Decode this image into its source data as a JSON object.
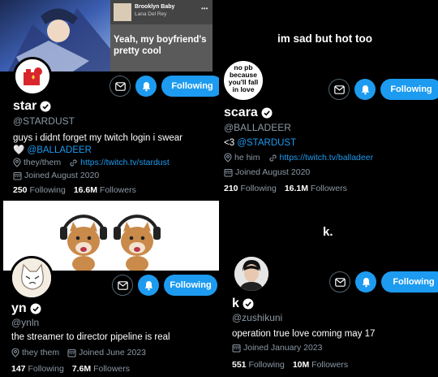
{
  "top_left": {
    "banner_post": {
      "song_title": "Brooklyn Baby",
      "artist": "Lana Del Rey",
      "text": "Yeah, my boyfriend's pretty cool"
    },
    "name": "star",
    "handle": "@STARDUST",
    "bio_text": "guys i didnt forget my twitch login i swear",
    "bio_heart": "🤍",
    "bio_mention": "@BALLADEER",
    "pronouns": "they/them",
    "link": "https://twitch.tv/stardust",
    "joined": "Joined August 2020",
    "following_count": "250",
    "following_label": "Following",
    "followers_count": "16.6M",
    "followers_label": "Followers",
    "follow_label": "Following"
  },
  "top_right": {
    "caption": "im sad but hot too",
    "avatar_text": "no pb because you'll fall in love",
    "name": "scara",
    "handle": "@BALLADEER",
    "bio_prefix": "<3",
    "bio_mention": "@STARDUST",
    "pronouns": "he him",
    "link": "https://twitch.tv/balladeer",
    "joined": "Joined August 2020",
    "following_count": "210",
    "following_label": "Following",
    "followers_count": "16.1M",
    "followers_label": "Followers",
    "follow_label": "Following"
  },
  "bottom_left": {
    "name": "yn",
    "handle": "@ynln",
    "bio_text": "the streamer to director pipeline is real",
    "pronouns": "they them",
    "joined": "Joined June 2023",
    "following_count": "147",
    "following_label": "Following",
    "followers_count": "7.6M",
    "followers_label": "Followers",
    "follow_label": "Following"
  },
  "bottom_right": {
    "caption": "k.",
    "name": "k",
    "handle": "@zushikuni",
    "bio_text": "operation true love coming may 17",
    "joined": "Joined January 2023",
    "following_count": "551",
    "following_label": "Following",
    "followers_count": "10M",
    "followers_label": "Followers",
    "follow_label": "Following"
  },
  "colors": {
    "accent": "#1d9bf0",
    "muted": "#8b98a5",
    "background": "#000000"
  }
}
